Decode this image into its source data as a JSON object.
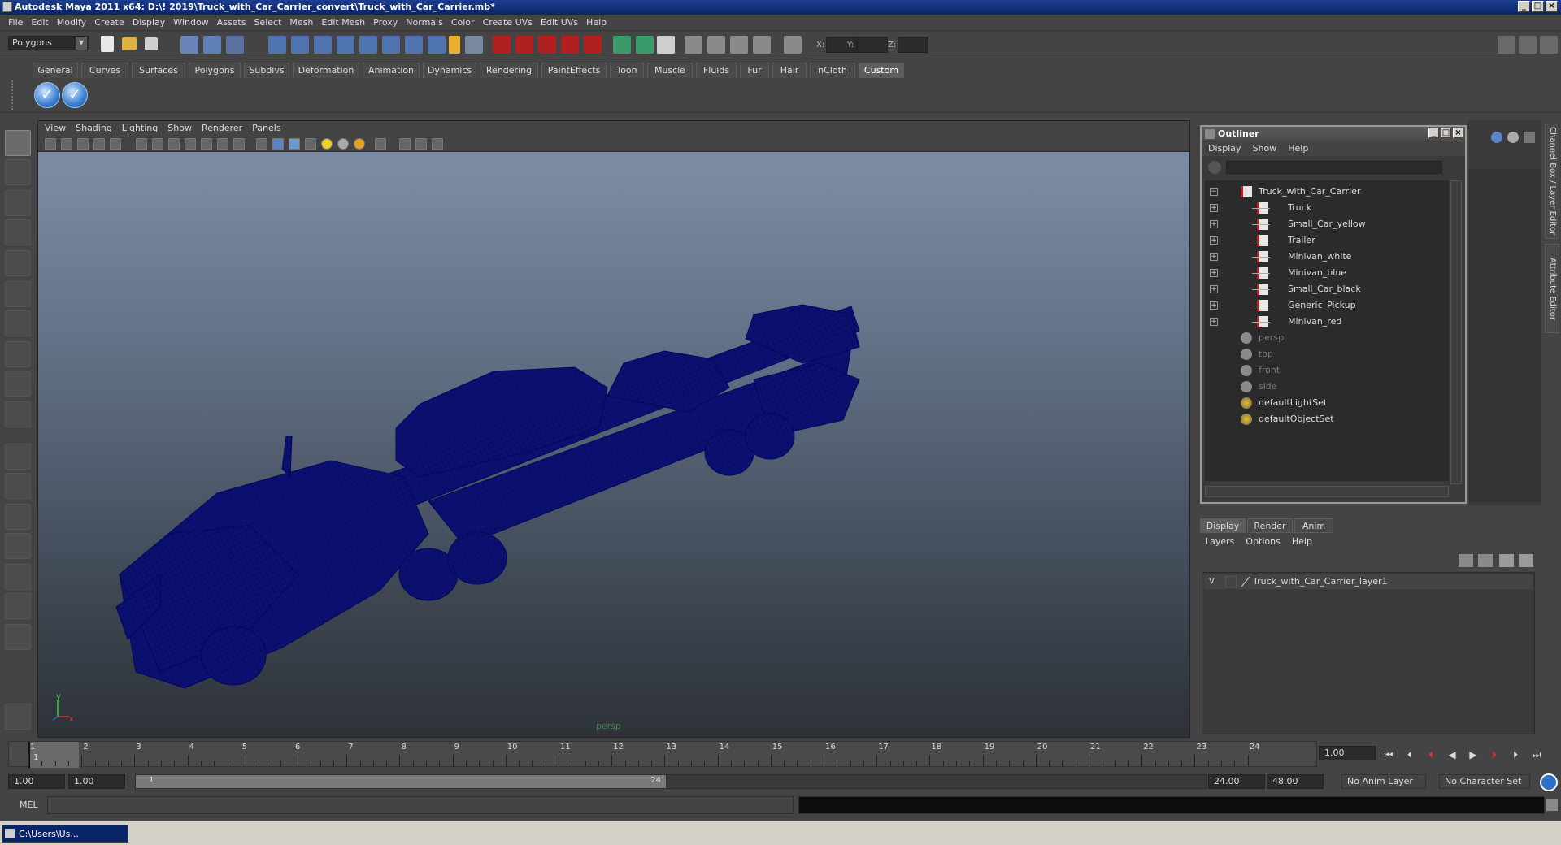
{
  "window": {
    "title": "Autodesk Maya 2011 x64: D:\\! 2019\\Truck_with_Car_Carrier_convert\\Truck_with_Car_Carrier.mb*"
  },
  "menubar": [
    "File",
    "Edit",
    "Modify",
    "Create",
    "Display",
    "Window",
    "Assets",
    "Select",
    "Mesh",
    "Edit Mesh",
    "Proxy",
    "Normals",
    "Color",
    "Create UVs",
    "Edit UVs",
    "Help"
  ],
  "statusline": {
    "mode": "Polygons",
    "x_label": "X:",
    "y_label": "Y:",
    "z_label": "Z:"
  },
  "shelf": {
    "tabs": [
      "General",
      "Curves",
      "Surfaces",
      "Polygons",
      "Subdivs",
      "Deformation",
      "Animation",
      "Dynamics",
      "Rendering",
      "PaintEffects",
      "Toon",
      "Muscle",
      "Fluids",
      "Fur",
      "Hair",
      "nCloth",
      "Custom"
    ],
    "active_tab": "Custom"
  },
  "viewport": {
    "menu": [
      "View",
      "Shading",
      "Lighting",
      "Show",
      "Renderer",
      "Panels"
    ],
    "camera": "persp",
    "axis_x": "x",
    "axis_y": "y",
    "wire_color": "#0b1170"
  },
  "outliner": {
    "title": "Outliner",
    "menu": [
      "Display",
      "Show",
      "Help"
    ],
    "items": [
      {
        "label": "Truck_with_Car_Carrier",
        "indent": 0,
        "expander": "−",
        "type": "mesh",
        "dim": false
      },
      {
        "label": "Truck",
        "indent": 1,
        "expander": "+",
        "type": "mesh",
        "dim": false
      },
      {
        "label": "Small_Car_yellow",
        "indent": 1,
        "expander": "+",
        "type": "mesh",
        "dim": false
      },
      {
        "label": "Trailer",
        "indent": 1,
        "expander": "+",
        "type": "mesh",
        "dim": false
      },
      {
        "label": "Minivan_white",
        "indent": 1,
        "expander": "+",
        "type": "mesh",
        "dim": false
      },
      {
        "label": "Minivan_blue",
        "indent": 1,
        "expander": "+",
        "type": "mesh",
        "dim": false
      },
      {
        "label": "Small_Car_black",
        "indent": 1,
        "expander": "+",
        "type": "mesh",
        "dim": false
      },
      {
        "label": "Generic_Pickup",
        "indent": 1,
        "expander": "+",
        "type": "mesh",
        "dim": false
      },
      {
        "label": "Minivan_red",
        "indent": 1,
        "expander": "+",
        "type": "mesh",
        "dim": false
      },
      {
        "label": "persp",
        "indent": 0,
        "expander": "",
        "type": "camera",
        "dim": true
      },
      {
        "label": "top",
        "indent": 0,
        "expander": "",
        "type": "camera",
        "dim": true
      },
      {
        "label": "front",
        "indent": 0,
        "expander": "",
        "type": "camera",
        "dim": true
      },
      {
        "label": "side",
        "indent": 0,
        "expander": "",
        "type": "camera",
        "dim": true
      },
      {
        "label": "defaultLightSet",
        "indent": 0,
        "expander": "",
        "type": "set",
        "dim": false
      },
      {
        "label": "defaultObjectSet",
        "indent": 0,
        "expander": "",
        "type": "set",
        "dim": false
      }
    ]
  },
  "layers": {
    "tabs": [
      "Display",
      "Render",
      "Anim"
    ],
    "active_tab": "Display",
    "menu": [
      "Layers",
      "Options",
      "Help"
    ],
    "rows": [
      {
        "visible": "V",
        "name": "Truck_with_Car_Carrier_layer1"
      }
    ]
  },
  "side_tabs": [
    "Channel Box / Layer Editor",
    "Attribute Editor"
  ],
  "timeline": {
    "ticks": [
      "1",
      "2",
      "3",
      "4",
      "5",
      "6",
      "7",
      "8",
      "9",
      "10",
      "11",
      "12",
      "13",
      "14",
      "15",
      "16",
      "17",
      "18",
      "19",
      "20",
      "21",
      "22",
      "23",
      "24"
    ],
    "current_frame_marker": "1",
    "current_time": "1.00"
  },
  "range": {
    "start_time": "1.00",
    "playback_start": "1.00",
    "range_start": "1",
    "range_end": "24",
    "playback_end": "24.00",
    "end_time": "48.00",
    "anim_layer": "No Anim Layer",
    "character_set": "No Character Set"
  },
  "command_line": {
    "label": "MEL"
  },
  "taskbar": {
    "item": "C:\\Users\\Us..."
  }
}
